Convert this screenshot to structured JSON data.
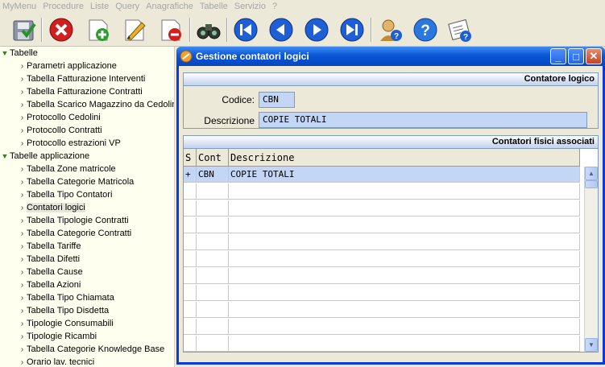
{
  "menubar": [
    "MyMenu",
    "Procedure",
    "Liste",
    "Query",
    "Anagrafiche",
    "Tabelle",
    "Servizio",
    "?"
  ],
  "toolbar": {
    "save": "save-icon",
    "delete": "delete-icon",
    "add": "add-icon",
    "edit": "edit-icon",
    "remove": "remove-icon",
    "find": "binoculars-icon",
    "first": "first-icon",
    "prev": "prev-icon",
    "next": "next-icon",
    "last": "last-icon",
    "user_help": "user-help-icon",
    "help": "help-icon",
    "about": "about-icon"
  },
  "tree": {
    "groups": [
      {
        "label": "Tabelle",
        "items": [
          "Parametri applicazione",
          "Tabella Fatturazione Interventi",
          "Tabella Fatturazione Contratti",
          "Tabella Scarico Magazzino da Cedolini",
          "Protocollo Cedolini",
          "Protocollo Contratti",
          "Protocollo estrazioni VP"
        ]
      },
      {
        "label": "Tabelle applicazione",
        "items": [
          "Tabella Zone matricole",
          "Tabella Categorie Matricola",
          "Tabella Tipo Contatori",
          "Contatori logici",
          "Tabella Tipologie Contratti",
          "Tabella Categorie Contratti",
          "Tabella Tariffe",
          "Tabella Difetti",
          "Tabella Cause",
          "Tabella Azioni",
          "Tabella Tipo Chiamata",
          "Tabella Tipo Disdetta",
          "Tipologie Consumabili",
          "Tipologie Ricambi",
          "Tabella Categorie Knowledge Base",
          "Orario lav. tecnici"
        ]
      }
    ],
    "selected": "Contatori logici"
  },
  "window": {
    "title": "Gestione contatori logici",
    "minimize": "_",
    "maximize": "□",
    "close": "✕"
  },
  "logico": {
    "header": "Contatore logico",
    "codice_label": "Codice:",
    "codice_value": "CBN",
    "descr_label": "Descrizione",
    "descr_value": "COPIE TOTALI"
  },
  "fisici": {
    "header": "Contatori fisici associati",
    "columns": [
      "S",
      "Cont",
      "Descrizione"
    ],
    "rows": [
      {
        "s": "+",
        "cont": "CBN",
        "descr": "COPIE TOTALI"
      }
    ],
    "empty_rows": 10
  },
  "colors": {
    "titlebar": "#0a57d6",
    "selection": "#c3d6f5",
    "tree_bg": "#fffff0",
    "close": "#c64125"
  }
}
